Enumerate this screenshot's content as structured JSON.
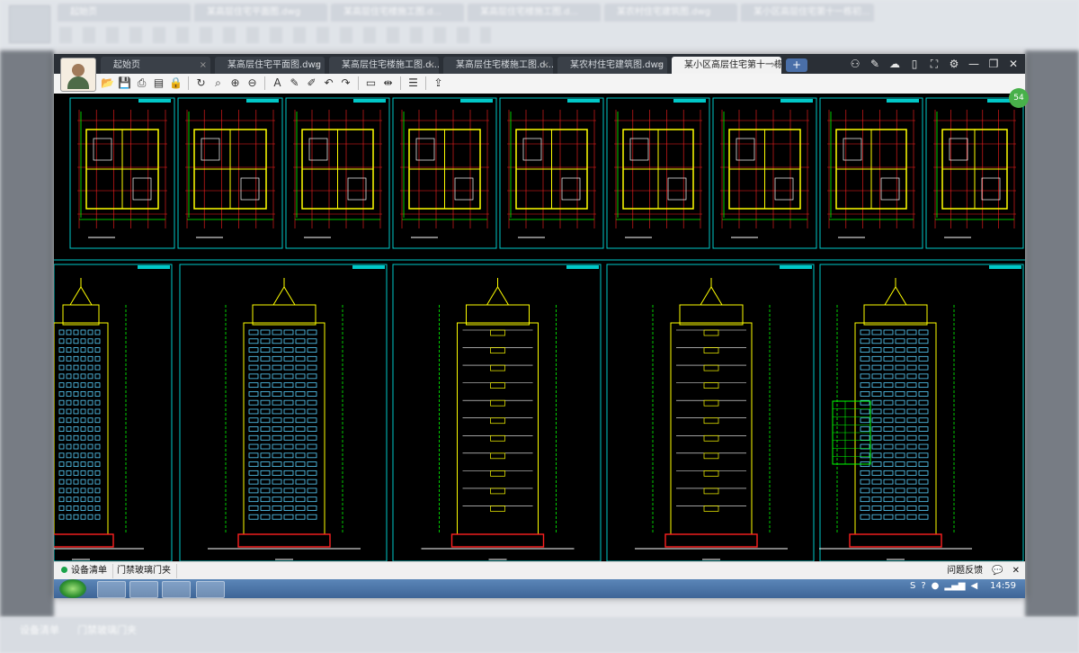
{
  "window": {
    "tabs": [
      {
        "label": "起始页"
      },
      {
        "label": "某高层住宅平面图.dwg"
      },
      {
        "label": "某高层住宅楼施工图.d..."
      },
      {
        "label": "某高层住宅楼施工图.d..."
      },
      {
        "label": "某农村住宅建筑图.dwg"
      },
      {
        "label": "某小区高层住宅第十一栋初..."
      }
    ],
    "tab_close_glyph": "×",
    "tab_add_glyph": "+",
    "controls": {
      "minimize": "—",
      "restore": "❐",
      "close": "✕"
    }
  },
  "toolbar": {
    "icons": [
      "open-icon",
      "save-icon",
      "print-icon",
      "pdf-icon",
      "lock-icon",
      "redraw-icon",
      "zoom-window-icon",
      "zoom-in-icon",
      "zoom-out-icon",
      "text-icon",
      "pencil-icon",
      "markup-icon",
      "undo-icon",
      "redo-icon",
      "measure-icon",
      "dimension-icon",
      "layers-icon",
      "export-icon"
    ]
  },
  "status": {
    "tab1": "设备清单",
    "tab2": "门禁玻璃门夹",
    "feedback": "问题反馈",
    "comment_glyph": "💬",
    "close_glyph": "✕"
  },
  "taskbar": {
    "clock": "14:59"
  },
  "badge": "54",
  "colors": {
    "canvas": "#000000",
    "frame": "#00c8c8",
    "wall": "#ffff00",
    "grid": "#ff2020",
    "window": "#5ad2ff",
    "dim": "#00ff00"
  }
}
